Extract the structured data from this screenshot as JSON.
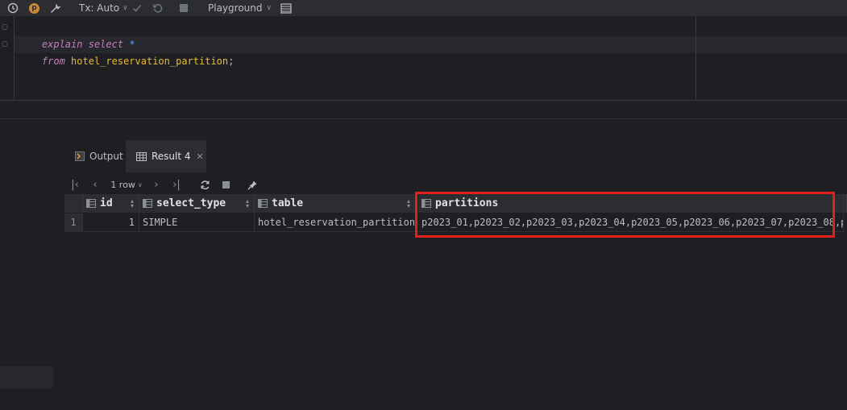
{
  "toolbar": {
    "profile_letter": "p",
    "tx_label": "Tx: Auto",
    "playground_label": "Playground"
  },
  "editor": {
    "line1": {
      "kw1": "explain",
      "kw2": "select",
      "star": "*"
    },
    "line2": {
      "kw": "from",
      "table": "hotel_reservation_partition",
      "end": ";"
    }
  },
  "tabs": {
    "output": "Output",
    "result": "Result 4"
  },
  "result_nav": {
    "row_count": "1 row"
  },
  "grid": {
    "columns": [
      "id",
      "select_type",
      "table",
      "partitions"
    ],
    "row_number": "1",
    "rows": [
      {
        "id": "1",
        "select_type": "SIMPLE",
        "table": "hotel_reservation_partition",
        "partitions": "p2023_01,p2023_02,p2023_03,p2023_04,p2023_05,p2023_06,p2023_07,p2023_08,p…"
      }
    ]
  },
  "colors": {
    "highlight": "#e3201b",
    "keyword": "#c77dbb",
    "identifier": "#e8ba36"
  }
}
